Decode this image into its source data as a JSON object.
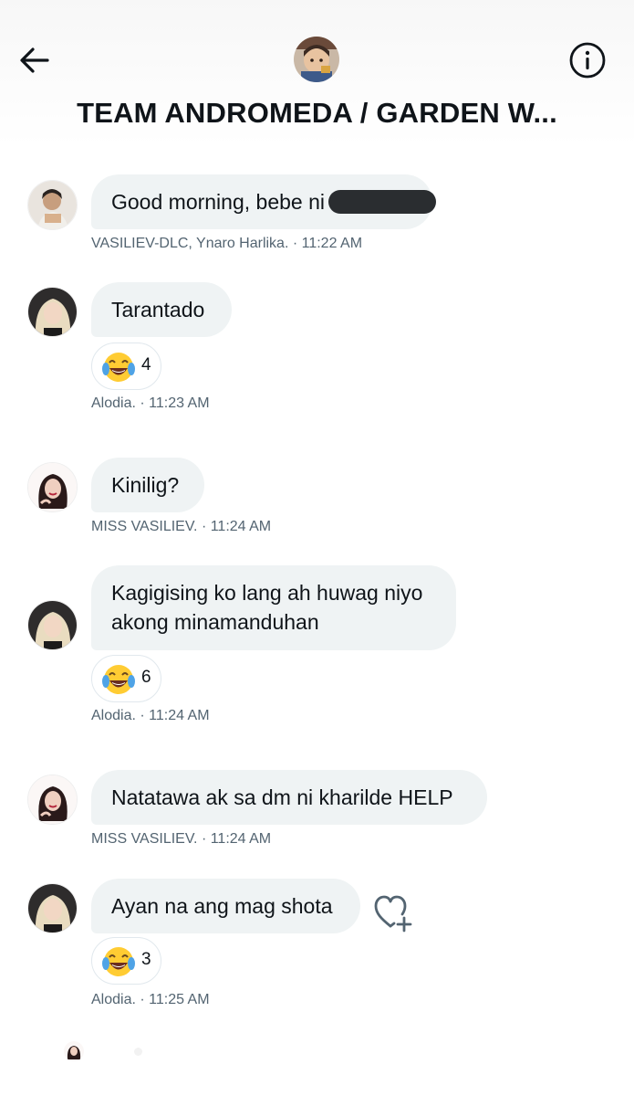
{
  "header": {
    "title": "TEAM ANDROMEDA / GARDEN W...",
    "back_icon": "arrow-left-icon",
    "info_icon": "info-circle-icon"
  },
  "messages": [
    {
      "text": "Good morning, bebe ni",
      "redacted": true,
      "meta": "VASILIEV-DLC, Ynaro Harlika. · 11:22 AM"
    },
    {
      "text": "Tarantado",
      "reaction": {
        "emoji": "😂",
        "count": "4"
      },
      "meta": "Alodia. · 11:23 AM"
    },
    {
      "text": "Kinilig?",
      "meta": "MISS VASILIEV. · 11:24 AM"
    },
    {
      "text_line1": "Kagigising ko lang ah huwag niyo",
      "text_line2": "akong minamanduhan",
      "reaction": {
        "emoji": "😂",
        "count": "6"
      },
      "meta": "Alodia. · 11:24 AM"
    },
    {
      "text": "Natatawa ak sa dm ni kharilde HELP",
      "meta": "MISS VASILIEV. · 11:24 AM"
    },
    {
      "text": "Ayan na ang mag shota",
      "reaction": {
        "emoji": "😂",
        "count": "3"
      },
      "meta": "Alodia. · 11:25 AM"
    }
  ],
  "colors": {
    "bubble": "#eff3f4",
    "meta_text": "#536471",
    "primary_text": "#0f1419"
  }
}
